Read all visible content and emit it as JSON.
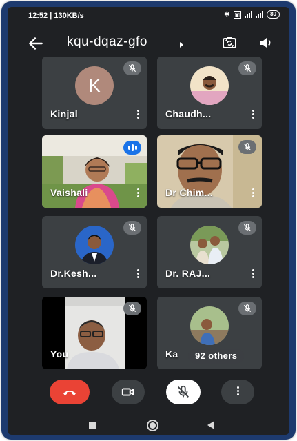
{
  "status_bar": {
    "time": "12:52",
    "speed": "130KB/s",
    "battery": "80"
  },
  "app_bar": {
    "meeting_code": "kqu-dqaz-gfo",
    "back_icon": "arrow-left-icon",
    "switch_camera_icon": "switch-camera-icon",
    "speaker_icon": "speaker-icon"
  },
  "participants": [
    {
      "name": "Kinjal",
      "avatar_letter": "K",
      "muted": true,
      "type": "letter"
    },
    {
      "name": "Chaudh...",
      "muted": true,
      "type": "photo"
    },
    {
      "name": "Vaishali",
      "muted": false,
      "speaking": true,
      "type": "video"
    },
    {
      "name": "Dr Chim...",
      "muted": true,
      "type": "video"
    },
    {
      "name": "Dr.Kesh...",
      "muted": true,
      "type": "photo"
    },
    {
      "name": "Dr. RAJ...",
      "muted": true,
      "type": "photo"
    },
    {
      "name": "You",
      "muted": true,
      "type": "video"
    },
    {
      "name": "Ka",
      "muted": true,
      "type": "photo",
      "others_count_label": "92 others"
    }
  ],
  "controls": {
    "end_call_icon": "end-call-icon",
    "camera_icon": "video-camera-icon",
    "mic_icon": "mic-off-icon",
    "more_icon": "more-vertical-icon"
  },
  "colors": {
    "background": "#1f2124",
    "tile": "#3c4043",
    "end_call": "#ea4335",
    "speaking": "#1a73e8",
    "frame": "#1d3a6e"
  }
}
